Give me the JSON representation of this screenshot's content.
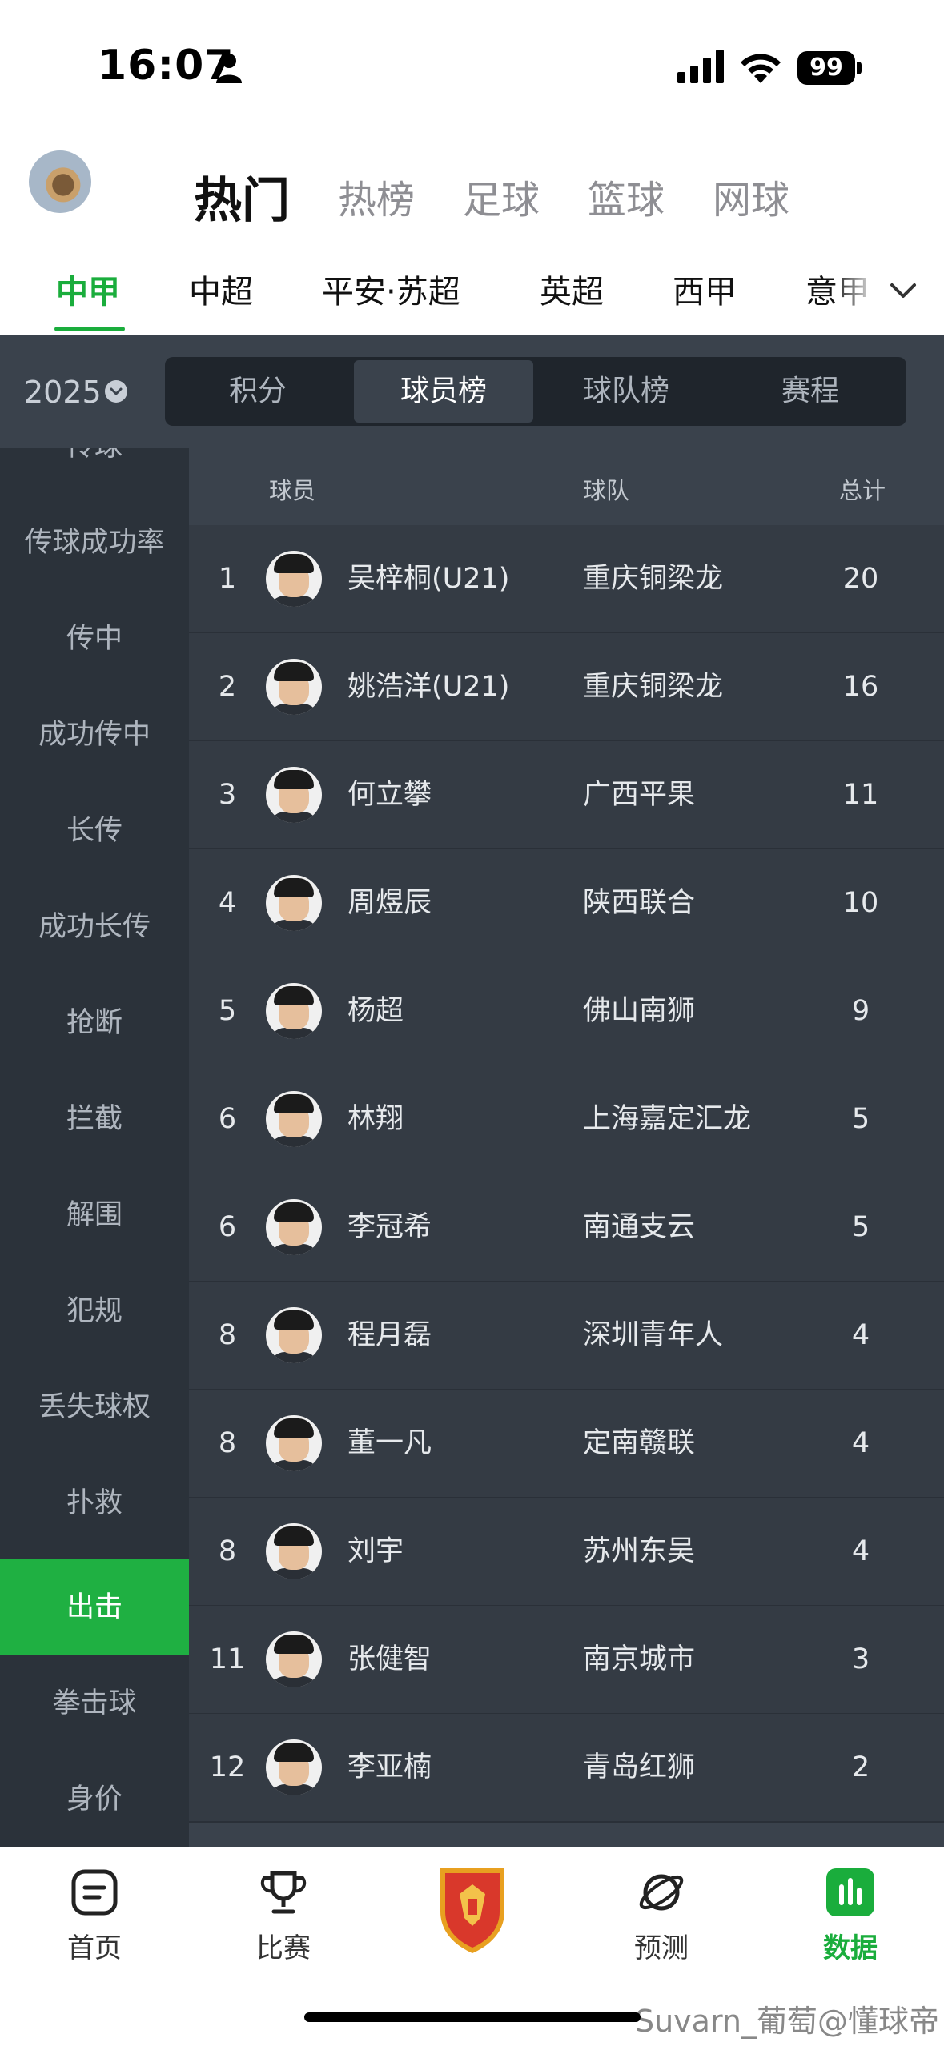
{
  "status_bar": {
    "time": "16:07",
    "battery": "99"
  },
  "top_tabs": [
    "热门",
    "热榜",
    "足球",
    "篮球",
    "网球"
  ],
  "league_tabs": [
    "中甲",
    "中超",
    "平安·苏超",
    "英超",
    "西甲",
    "意甲"
  ],
  "season": "2025",
  "segments": [
    "积分",
    "球员榜",
    "球队榜",
    "赛程"
  ],
  "sidebar": [
    "传球",
    "传球成功率",
    "传中",
    "成功传中",
    "长传",
    "成功长传",
    "抢断",
    "拦截",
    "解围",
    "犯规",
    "丢失球权",
    "扑救",
    "出击",
    "拳击球",
    "身价"
  ],
  "table": {
    "headers": {
      "player": "球员",
      "team": "球队",
      "total": "总计"
    },
    "rows": [
      {
        "rank": "1",
        "name": "吴梓桐(U21)",
        "team": "重庆铜梁龙",
        "total": "20"
      },
      {
        "rank": "2",
        "name": "姚浩洋(U21)",
        "team": "重庆铜梁龙",
        "total": "16"
      },
      {
        "rank": "3",
        "name": "何立攀",
        "team": "广西平果",
        "total": "11"
      },
      {
        "rank": "4",
        "name": "周煜辰",
        "team": "陕西联合",
        "total": "10"
      },
      {
        "rank": "5",
        "name": "杨超",
        "team": "佛山南狮",
        "total": "9"
      },
      {
        "rank": "6",
        "name": "林翔",
        "team": "上海嘉定汇龙",
        "total": "5"
      },
      {
        "rank": "6",
        "name": "李冠希",
        "team": "南通支云",
        "total": "5"
      },
      {
        "rank": "8",
        "name": "程月磊",
        "team": "深圳青年人",
        "total": "4"
      },
      {
        "rank": "8",
        "name": "董一凡",
        "team": "定南赣联",
        "total": "4"
      },
      {
        "rank": "8",
        "name": "刘宇",
        "team": "苏州东吴",
        "total": "4"
      },
      {
        "rank": "11",
        "name": "张健智",
        "team": "南京城市",
        "total": "3"
      },
      {
        "rank": "12",
        "name": "李亚楠",
        "team": "青岛红狮",
        "total": "2"
      }
    ]
  },
  "bottom_nav": [
    "首页",
    "比赛",
    "预测",
    "数据"
  ],
  "credit": "Suvarn_葡萄@懂球帝",
  "colors": {
    "accent": "#1aad3c",
    "dark_bg": "#3a424c",
    "sidebar_bg": "#2b323a"
  }
}
